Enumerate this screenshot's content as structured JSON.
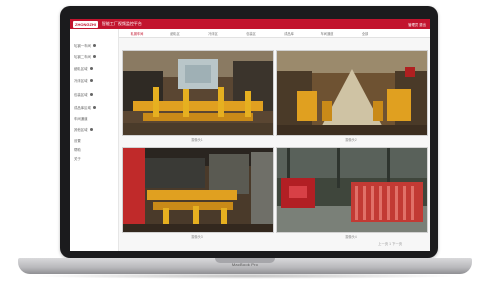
{
  "device": {
    "brand_label": "MacBook Pro"
  },
  "app": {
    "logo": "ZHONGZHI",
    "title": "智能工厂视频监控平台",
    "user": "管理员  退出"
  },
  "tabs": [
    {
      "label": "轧钢车间"
    },
    {
      "label": "细轧区"
    },
    {
      "label": "冷床区"
    },
    {
      "label": "包装区"
    },
    {
      "label": "成品库"
    },
    {
      "label": "车间通道"
    },
    {
      "label": "全部"
    }
  ],
  "sidebar": {
    "items": [
      {
        "label": "轧钢一车间",
        "has_dot": true
      },
      {
        "label": "轧钢二车间",
        "has_dot": true
      },
      {
        "label": "细轧区域",
        "has_dot": true
      },
      {
        "label": "冷床区域",
        "has_dot": true
      },
      {
        "label": "包装区域",
        "has_dot": true
      },
      {
        "label": "成品库区域",
        "has_dot": true
      },
      {
        "label": "车间通道",
        "has_dot": false
      },
      {
        "label": "其他区域",
        "has_dot": true
      },
      {
        "label": "设置",
        "has_dot": false
      },
      {
        "label": "帮助",
        "has_dot": false
      },
      {
        "label": "关于",
        "has_dot": false
      }
    ]
  },
  "cameras": [
    {
      "label": "摄像头1"
    },
    {
      "label": "摄像头2"
    },
    {
      "label": "摄像头3"
    },
    {
      "label": "摄像头4"
    }
  ],
  "pager": {
    "text": "上一页  1  下一页"
  },
  "colors": {
    "accent": "#c2142e",
    "frame": "#1b1b1d"
  }
}
